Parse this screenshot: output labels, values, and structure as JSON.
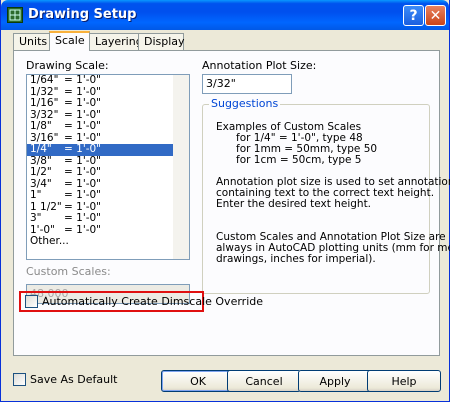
{
  "window": {
    "title": "Drawing Setup",
    "help_glyph": "?",
    "close_glyph": "✕"
  },
  "tabs": [
    {
      "label": "Units",
      "active": false
    },
    {
      "label": "Scale",
      "active": true
    },
    {
      "label": "Layering",
      "active": false
    },
    {
      "label": "Display",
      "active": false
    }
  ],
  "scale": {
    "drawing_scale_label": "Drawing Scale:",
    "scales": [
      {
        "a": "1/64\"",
        "b": "= 1'-0\""
      },
      {
        "a": "1/32\"",
        "b": "= 1'-0\""
      },
      {
        "a": "1/16\"",
        "b": "= 1'-0\""
      },
      {
        "a": "3/32\"",
        "b": "= 1'-0\""
      },
      {
        "a": "1/8\"",
        "b": "= 1'-0\""
      },
      {
        "a": "3/16\"",
        "b": "= 1'-0\""
      },
      {
        "a": "1/4\"",
        "b": "= 1'-0\""
      },
      {
        "a": "3/8\"",
        "b": "= 1'-0\""
      },
      {
        "a": "1/2\"",
        "b": "= 1'-0\""
      },
      {
        "a": "3/4\"",
        "b": "= 1'-0\""
      },
      {
        "a": "1\"",
        "b": "= 1'-0\""
      },
      {
        "a": "1 1/2\"",
        "b": "= 1'-0\""
      },
      {
        "a": "3\"",
        "b": "= 1'-0\""
      },
      {
        "a": "1'-0\"",
        "b": "= 1'-0\""
      },
      {
        "a": "Other...",
        "b": ""
      }
    ],
    "selected_index": 6,
    "custom_scales_label": "Custom Scales:",
    "custom_scales_value": "48.000",
    "annotation_label": "Annotation Plot Size:",
    "annotation_value": "3/32\"",
    "suggestions_title": "Suggestions",
    "suggestions_lines": [
      "Examples of Custom Scales",
      "      for 1/4\" = 1'-0\", type 48",
      "      for 1mm = 50mm, type 50",
      "      for 1cm = 50cm, type 5",
      "",
      "Annotation plot size is used to set annotation",
      "containing text to the correct text height.",
      "Enter the desired text height.",
      "",
      "",
      "Custom Scales and Annotation Plot Size are",
      "always in AutoCAD plotting units (mm for metric",
      "drawings, inches for imperial)."
    ],
    "auto_dimscale_label": "Automatically Create Dimscale Override",
    "auto_dimscale_checked": false
  },
  "footer": {
    "save_default_label": "Save As Default",
    "save_default_checked": false,
    "ok": "OK",
    "cancel": "Cancel",
    "apply": "Apply",
    "help": "Help"
  },
  "colors": {
    "title_bar": "#0054e3",
    "selection": "#316ac5",
    "highlight_border": "#e01010"
  }
}
